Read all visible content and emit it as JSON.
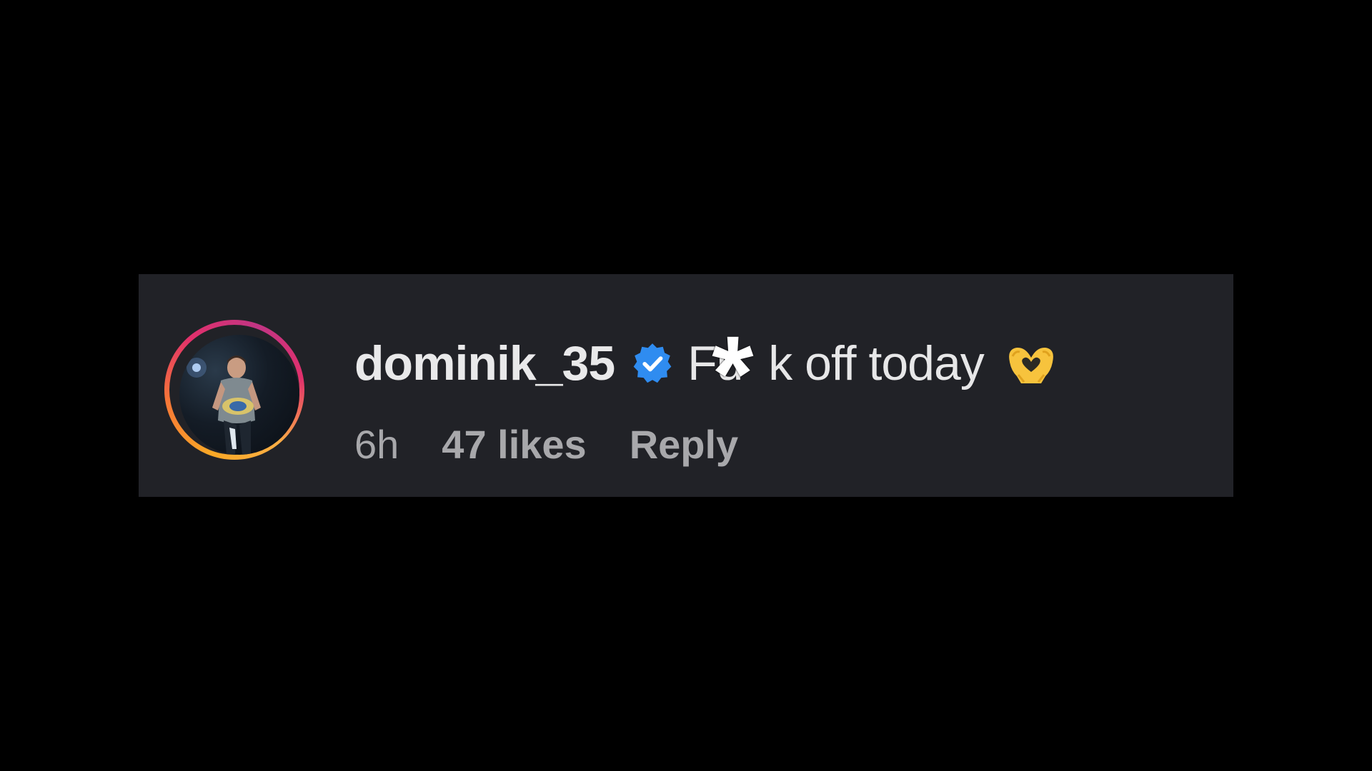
{
  "comment": {
    "username": "dominik_35",
    "verified": true,
    "text": "Fu  k off today",
    "censor_mark": "*",
    "emoji": "heart-hands-emoji",
    "time": "6h",
    "likes": "47 likes",
    "reply_label": "Reply"
  },
  "colors": {
    "background": "#000000",
    "card": "#212227",
    "username": "#e9e9ea",
    "meta": "#a8a8ab",
    "verified_badge": "#2f8cf0",
    "ring_orange": "#f9a826",
    "ring_pink": "#e1306c"
  }
}
